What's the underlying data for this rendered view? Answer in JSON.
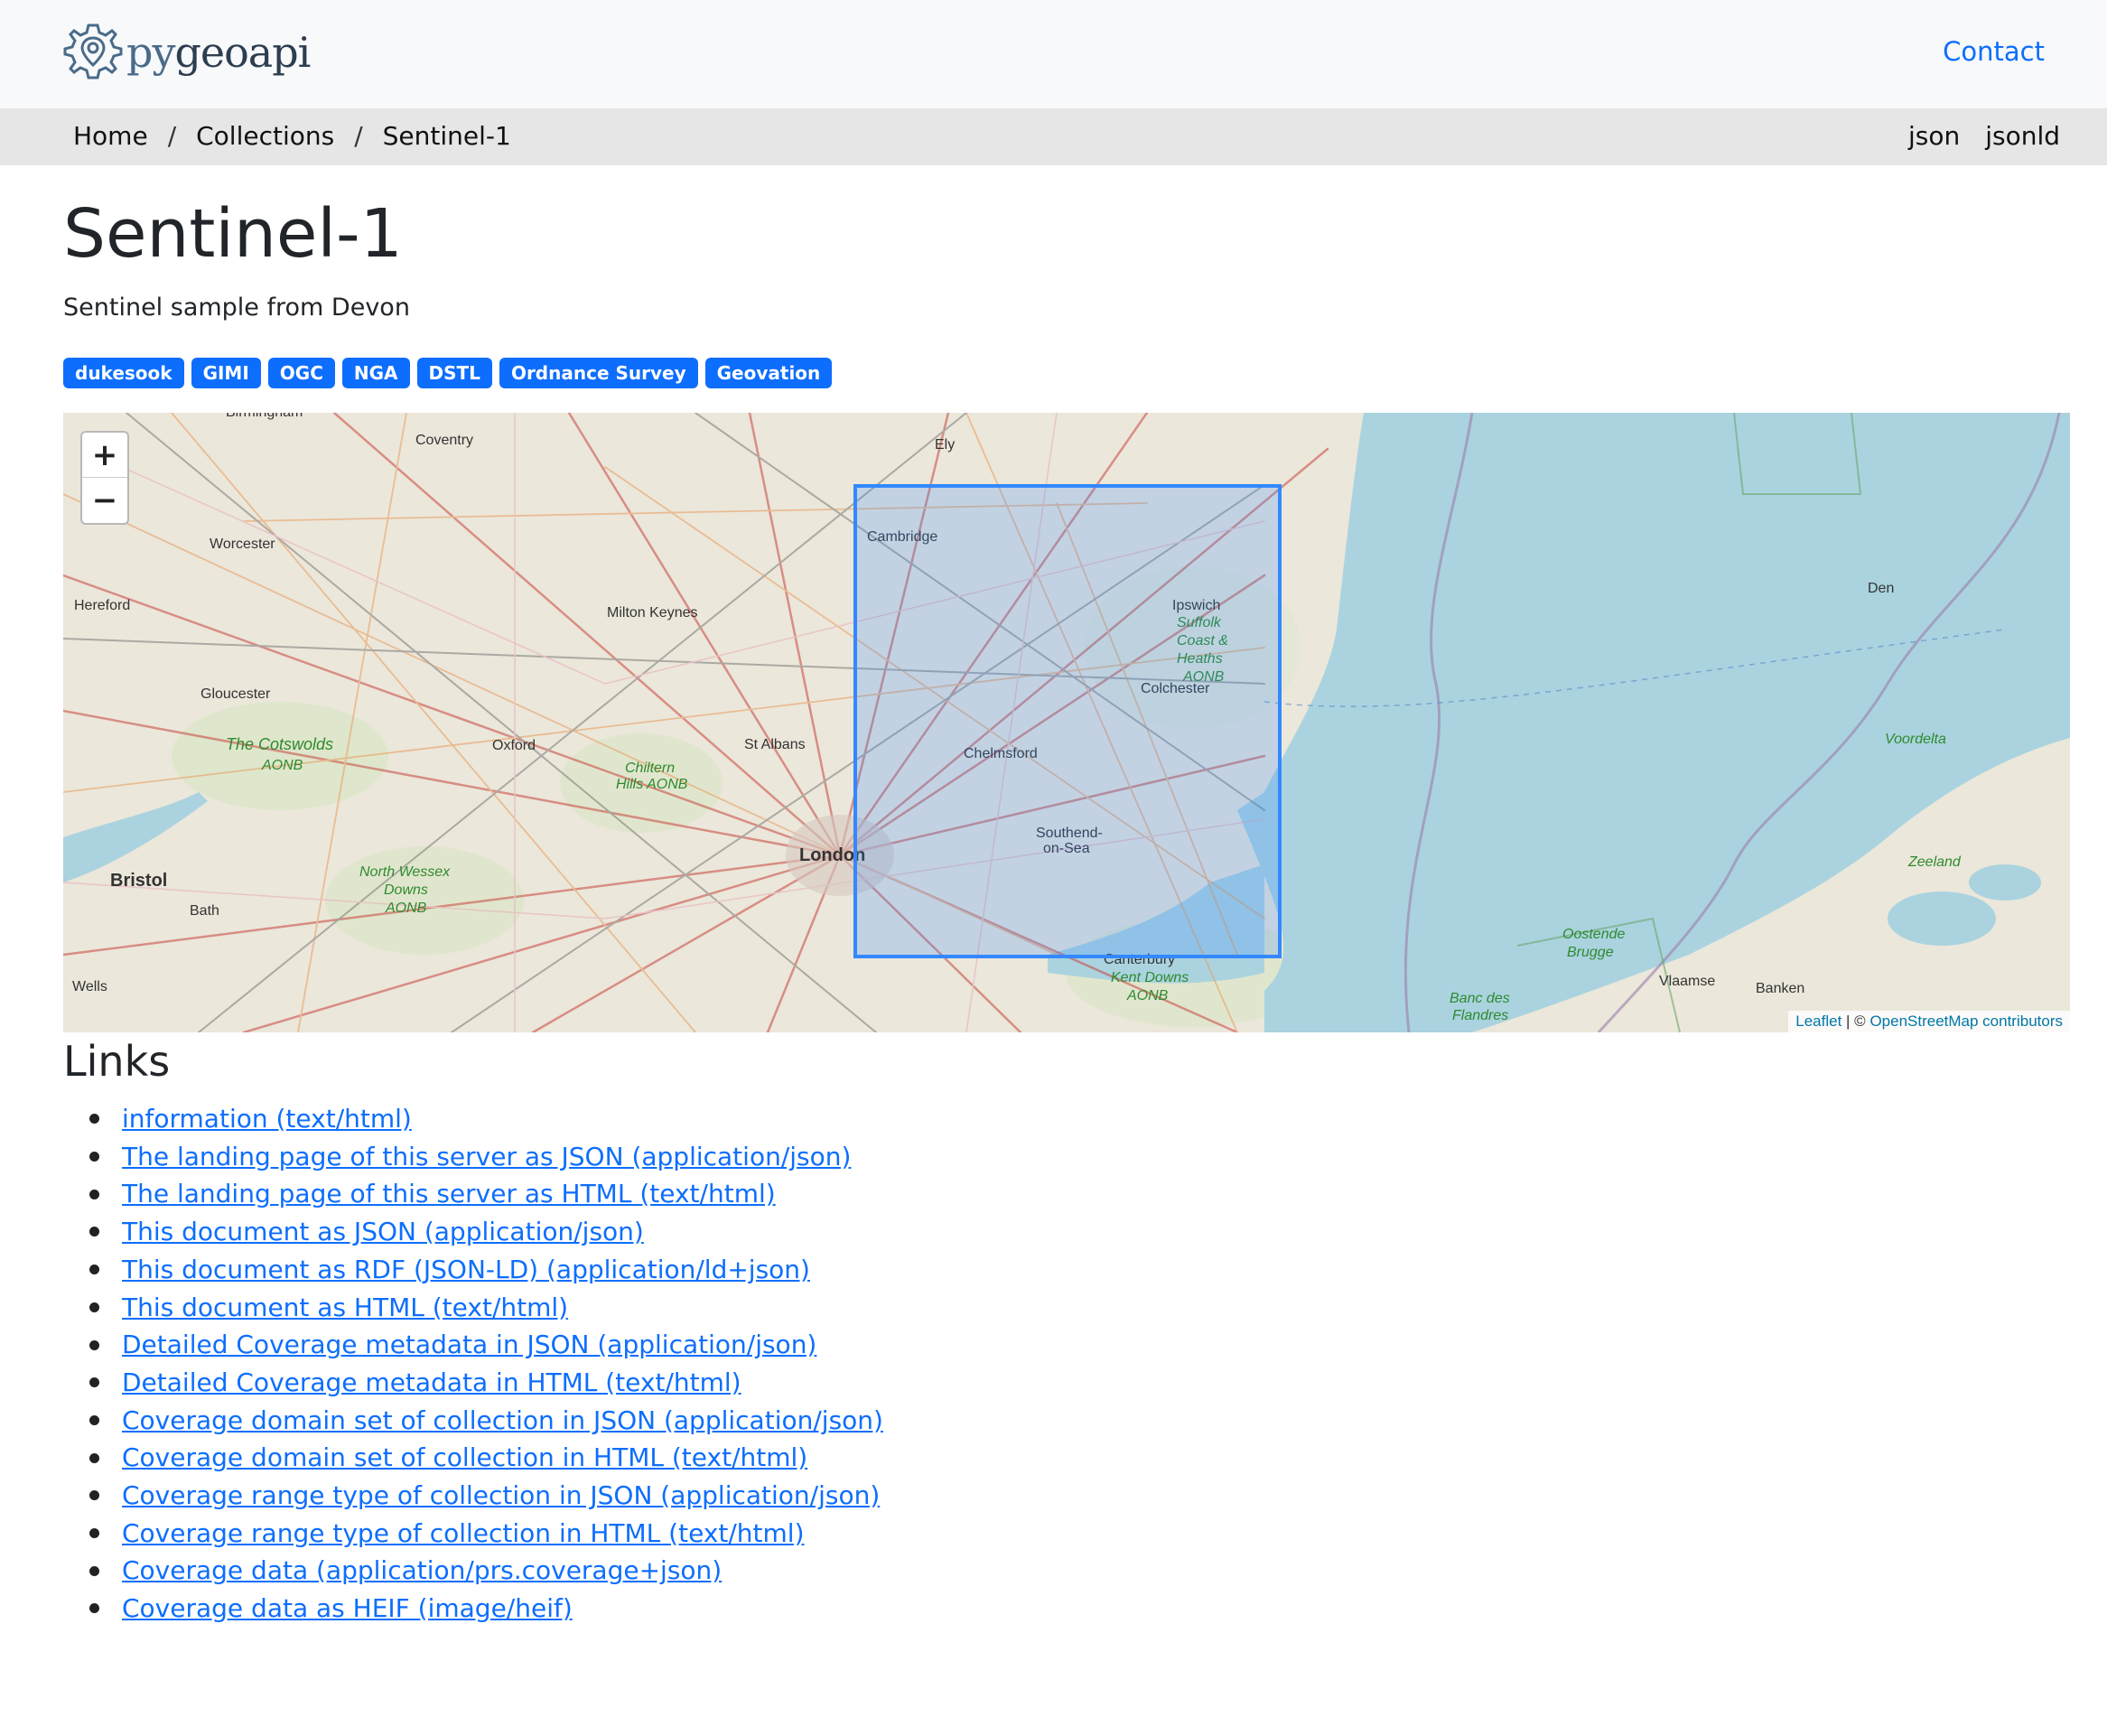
{
  "header": {
    "logo_text": "pygeoapi",
    "logo_prefix": "py",
    "logo_suffix": "geoapi",
    "contact_label": "Contact"
  },
  "breadcrumb": {
    "items": [
      "Home",
      "Collections",
      "Sentinel-1"
    ],
    "separator": "/"
  },
  "formats": [
    "json",
    "jsonld"
  ],
  "page": {
    "title": "Sentinel-1",
    "description": "Sentinel sample from Devon"
  },
  "keywords": [
    "dukesook",
    "GIMI",
    "OGC",
    "NGA",
    "DSTL",
    "Ordnance Survey",
    "Geovation"
  ],
  "map": {
    "zoom_in": "+",
    "zoom_out": "−",
    "attribution_leaflet": "Leaflet",
    "attribution_sep": " | © ",
    "attribution_osm": "OpenStreetMap contributors",
    "places": [
      "Birmingham",
      "Coventry",
      "Ely",
      "Cambridge",
      "Worcester",
      "Hereford",
      "Milton Keynes",
      "Ipswich",
      "Suffolk",
      "Coast &",
      "Heaths",
      "AONB",
      "Colchester",
      "Gloucester",
      "The Cotswolds",
      "AONB",
      "Oxford",
      "St Albans",
      "Chelmsford",
      "Chiltern",
      "Hills AONB",
      "London",
      "Southend-",
      "on-Sea",
      "Bristol",
      "North Wessex",
      "Downs",
      "AONB",
      "Bath",
      "Wells",
      "Canterbury",
      "Kent Downs",
      "AONB",
      "Voordelta",
      "Zeeland",
      "Vlaamse",
      "Banken",
      "Oostende",
      "Brugge",
      "Banc des",
      "Flandres",
      "Den"
    ],
    "colors": {
      "land": "#ebe7da",
      "sea": "#aad3df",
      "bbox_stroke": "#3388ff",
      "bbox_fill": "rgba(51,136,255,0.2)"
    }
  },
  "links_section": {
    "title": "Links",
    "items": [
      "information (text/html)",
      "The landing page of this server as JSON (application/json)",
      "The landing page of this server as HTML (text/html)",
      "This document as JSON (application/json)",
      "This document as RDF (JSON-LD) (application/ld+json)",
      "This document as HTML (text/html)",
      "Detailed Coverage metadata in JSON (application/json)",
      "Detailed Coverage metadata in HTML (text/html)",
      "Coverage domain set of collection in JSON (application/json)",
      "Coverage domain set of collection in HTML (text/html)",
      "Coverage range type of collection in JSON (application/json)",
      "Coverage range type of collection in HTML (text/html)",
      "Coverage data (application/prs.coverage+json)",
      "Coverage data as HEIF (image/heif)"
    ]
  }
}
